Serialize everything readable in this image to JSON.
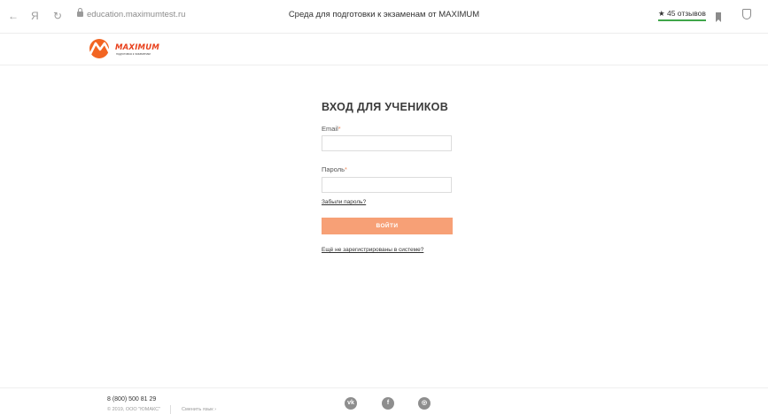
{
  "browser": {
    "back_icon": "←",
    "yandex_icon": "Я",
    "reload_icon": "↻",
    "url": "education.maximumtest.ru",
    "title": "Среда для подготовки к экзаменам от MAXIMUM",
    "reviews_label": "★ 45 отзывов"
  },
  "header": {
    "logo_text": "MAXIMUM",
    "logo_subtext": "подготовка к экзаменам",
    "brand_color": "#e8401c"
  },
  "login": {
    "title": "ВХОД ДЛЯ УЧЕНИКОВ",
    "email_label": "Email",
    "email_value": "",
    "password_label": "Пароль",
    "password_value": "",
    "required_mark": "*",
    "forgot_link": "Забыли пароль?",
    "submit_label": "ВОЙТИ",
    "register_link": "Ещё не зарегистрированы в системе?",
    "button_color": "#f7a076"
  },
  "footer": {
    "phone": "8 (800) 500 81 29",
    "copyright": "© 2019, ООО \"ЮМАКС\"",
    "language_switch": "Сменить язык ›",
    "social": {
      "vk": "vk",
      "facebook": "f",
      "instagram": "◎"
    }
  }
}
